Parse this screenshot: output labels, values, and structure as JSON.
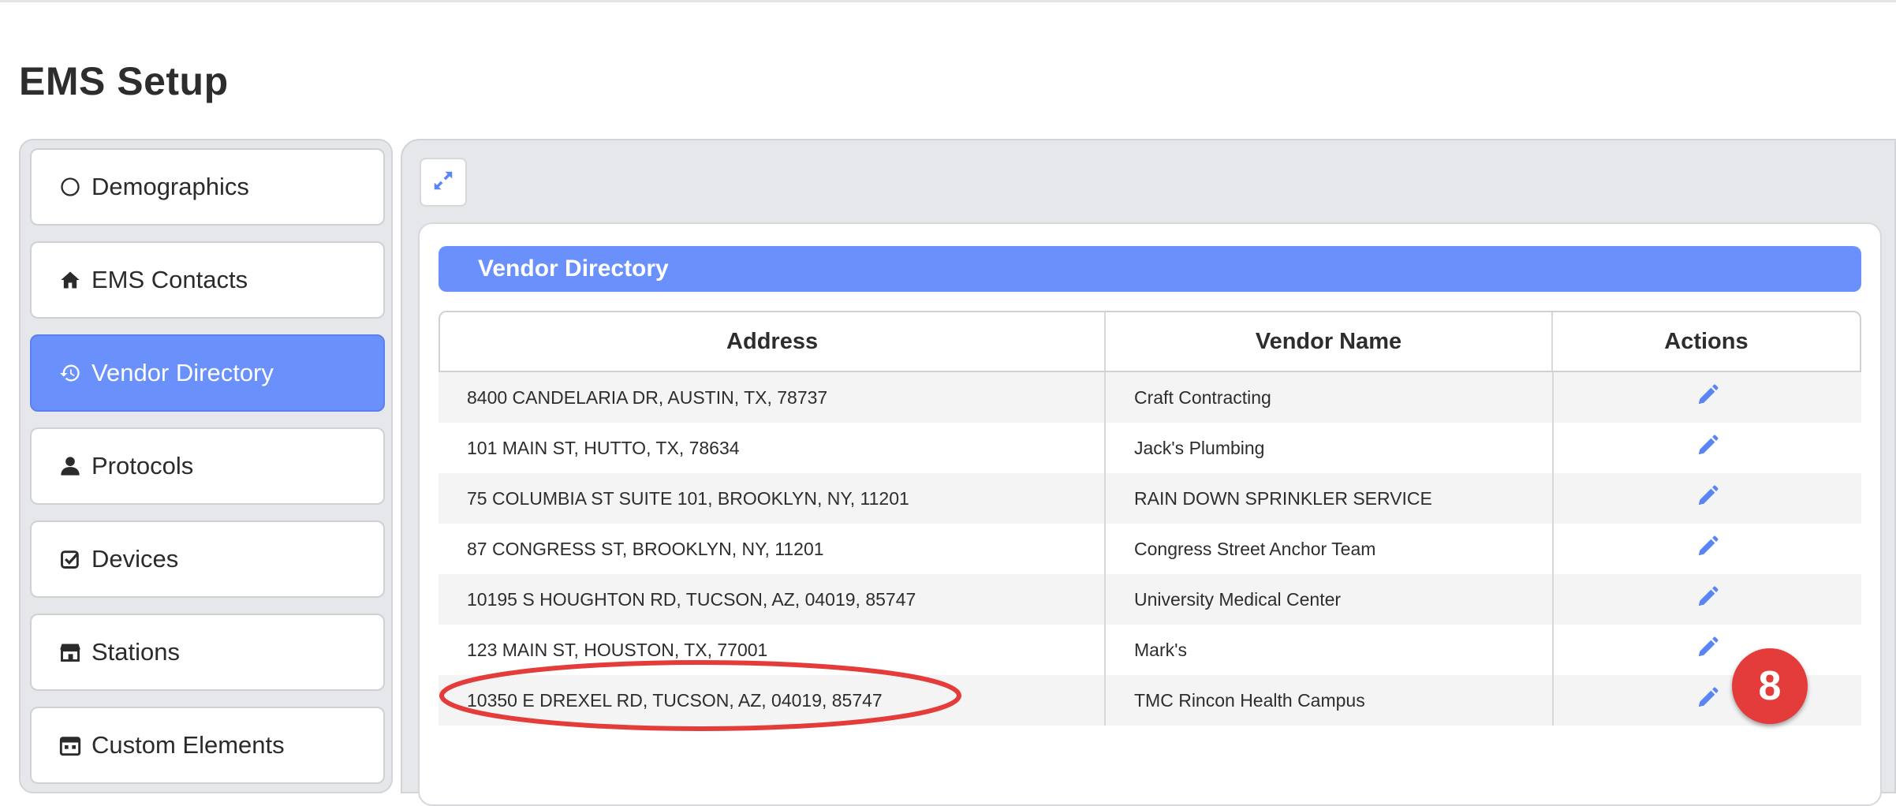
{
  "page": {
    "title": "EMS Setup"
  },
  "sidebar": {
    "items": [
      {
        "label": "Demographics",
        "icon": "circle-icon",
        "active": false
      },
      {
        "label": "EMS Contacts",
        "icon": "home-icon",
        "active": false
      },
      {
        "label": "Vendor Directory",
        "icon": "history-icon",
        "active": true
      },
      {
        "label": "Protocols",
        "icon": "user-icon",
        "active": false
      },
      {
        "label": "Devices",
        "icon": "checkbox-icon",
        "active": false
      },
      {
        "label": "Stations",
        "icon": "store-icon",
        "active": false
      },
      {
        "label": "Custom Elements",
        "icon": "calendar-icon",
        "active": false
      }
    ]
  },
  "toolbar": {
    "expand_icon": "expand-icon"
  },
  "directory": {
    "title": "Vendor Directory",
    "columns": {
      "address": "Address",
      "vendor": "Vendor Name",
      "actions": "Actions"
    },
    "rows": [
      {
        "address": "8400 CANDELARIA DR, AUSTIN, TX, 78737",
        "vendor": "Craft Contracting"
      },
      {
        "address": "101 MAIN ST, HUTTO, TX, 78634",
        "vendor": "Jack's Plumbing"
      },
      {
        "address": "75 COLUMBIA ST SUITE 101, BROOKLYN, NY, 11201",
        "vendor": "RAIN DOWN SPRINKLER SERVICE"
      },
      {
        "address": "87 CONGRESS ST, BROOKLYN, NY, 11201",
        "vendor": "Congress Street Anchor Team"
      },
      {
        "address": "10195 S HOUGHTON RD, TUCSON, AZ, 04019, 85747",
        "vendor": "University Medical Center"
      },
      {
        "address": "123 MAIN ST, HOUSTON, TX, 77001",
        "vendor": "Mark's"
      },
      {
        "address": "10350 E DREXEL RD, TUCSON, AZ, 04019, 85747",
        "vendor": "TMC Rincon Health Campus"
      }
    ],
    "action_icon": "pencil-icon"
  },
  "annotation": {
    "badge_number": "8",
    "color": "#e43b3b"
  },
  "colors": {
    "accent": "#6a90fb",
    "annotation": "#e43b3b"
  }
}
